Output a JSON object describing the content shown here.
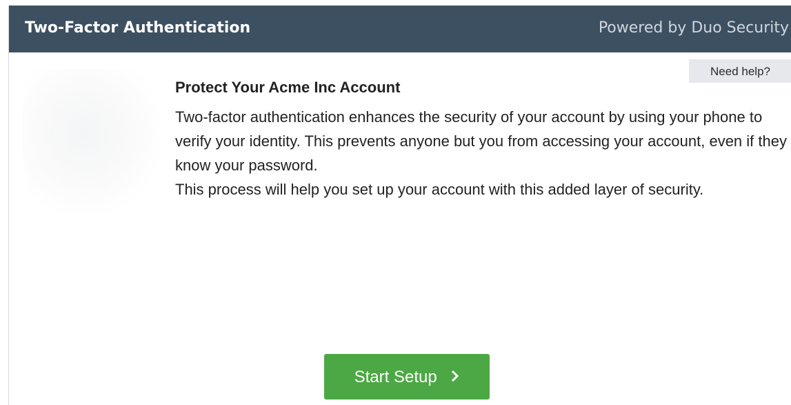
{
  "header": {
    "title": "Two-Factor Authentication",
    "powered_by": "Powered by Duo Security",
    "background_color": "#3d5061"
  },
  "help": {
    "label": "Need help?"
  },
  "main": {
    "title": "Protect Your Acme Inc Account",
    "paragraph_1": "Two-factor authentication enhances the security of your account by using your phone to verify your identity. This prevents anyone but you from accessing your account, even if they know your password.",
    "paragraph_2": "This process will help you set up your account with this added layer of security."
  },
  "actions": {
    "start_label": "Start Setup",
    "start_icon": "chevron-right-icon",
    "start_color": "#4ca844"
  }
}
